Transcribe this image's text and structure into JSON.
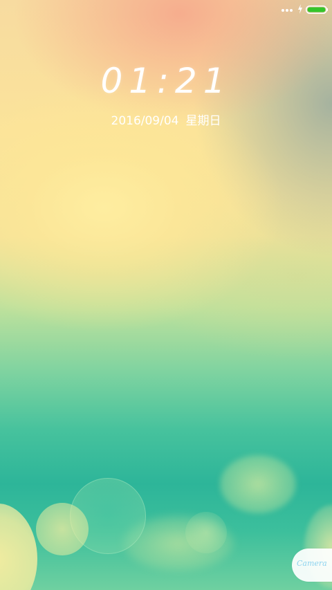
{
  "status_bar": {
    "icons": [
      "more-dots-icon",
      "charging-icon",
      "battery-icon"
    ],
    "battery_color": "#33c52a"
  },
  "lock_screen": {
    "time": "01:21",
    "date": "2016/09/04",
    "weekday": "星期日"
  },
  "shortcut": {
    "camera_label": "Camera"
  }
}
